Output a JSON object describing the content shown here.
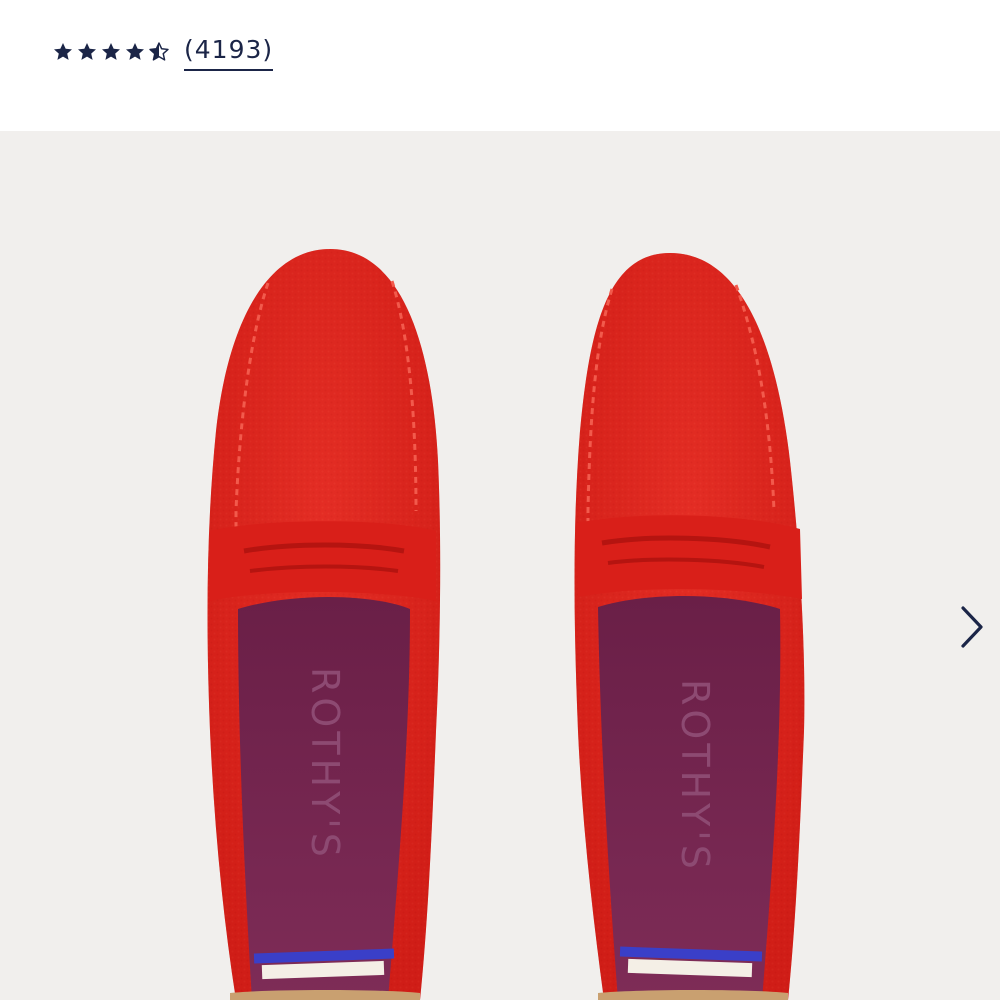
{
  "rating": {
    "value": 4.5,
    "out_of": 5,
    "review_count_label": "(4193)",
    "star_color": "#1b2547"
  },
  "gallery": {
    "background_color": "#f1efed",
    "product_color": "#e0261f",
    "lining_color": "#7a2a55",
    "insole_brand": "ROTHY'S",
    "next_icon": "chevron-right-icon"
  }
}
